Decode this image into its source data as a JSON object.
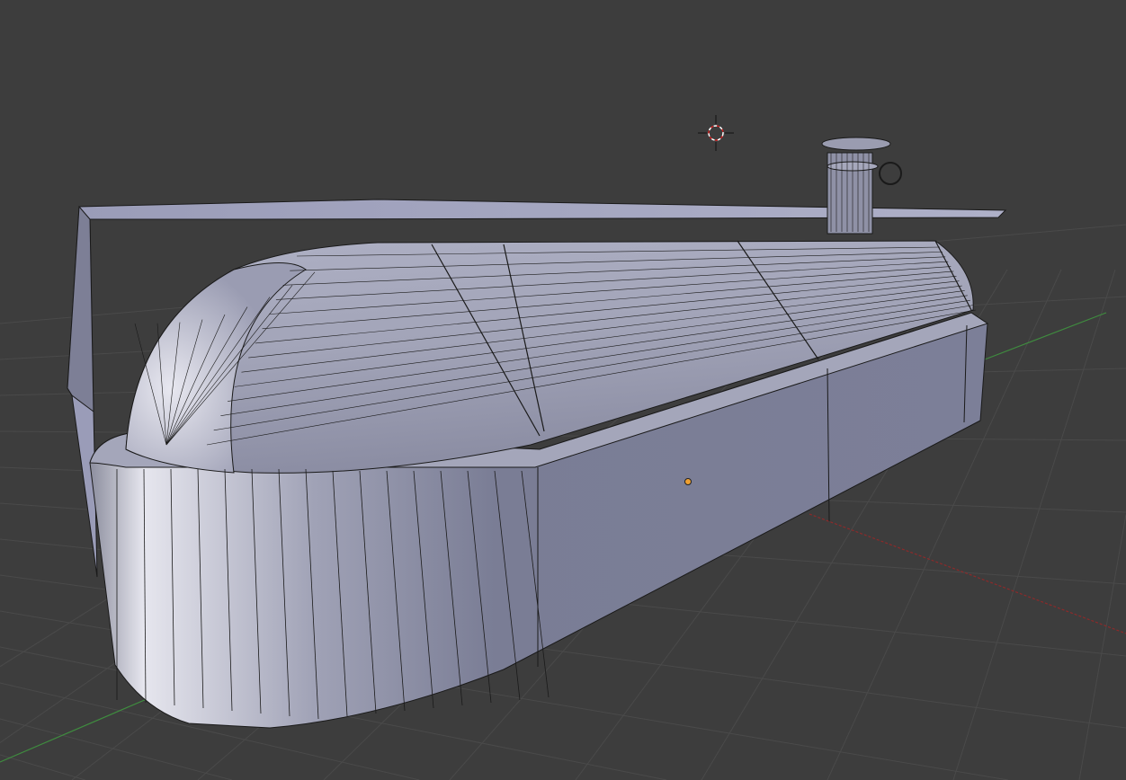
{
  "viewport": {
    "mode": "3d-viewport-edit-wireframe-overlay",
    "background_color": "#3d3d3d",
    "grid_color": "#4a4a4a",
    "x_axis_color": "#8c2a2a",
    "y_axis_color": "#3f8c3f",
    "mesh_color": "#9a9cb4",
    "wire_color": "#1a1a1a",
    "origin_color": "#f0a030",
    "icons": [
      "3d-cursor-icon",
      "object-origin-icon"
    ]
  }
}
